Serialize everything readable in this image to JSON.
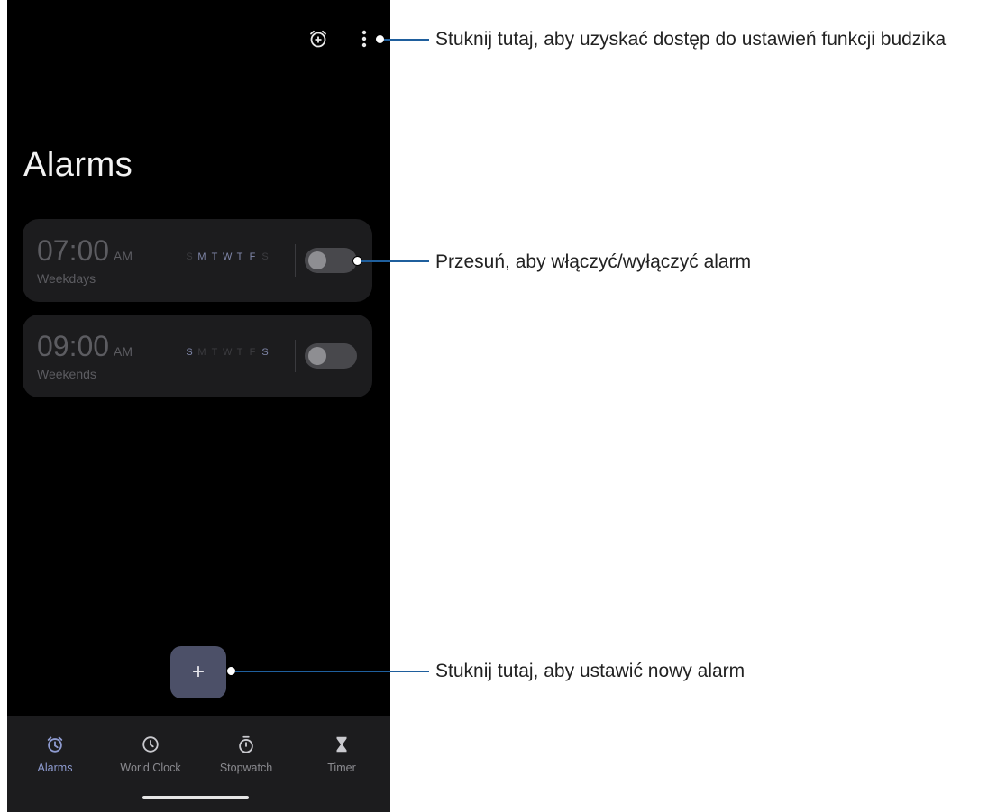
{
  "screen": {
    "title": "Alarms",
    "top_icons": [
      "add-alarm-icon",
      "more-vert-icon"
    ]
  },
  "alarms": [
    {
      "time": "07:00",
      "ampm": "AM",
      "label": "Weekdays",
      "days": [
        "S",
        "M",
        "T",
        "W",
        "T",
        "F",
        "S"
      ],
      "active_days": [
        false,
        true,
        true,
        true,
        true,
        true,
        false
      ],
      "enabled": false
    },
    {
      "time": "09:00",
      "ampm": "AM",
      "label": "Weekends",
      "days": [
        "S",
        "M",
        "T",
        "W",
        "T",
        "F",
        "S"
      ],
      "active_days": [
        true,
        false,
        false,
        false,
        false,
        false,
        true
      ],
      "enabled": false
    }
  ],
  "fab": {
    "symbol": "+"
  },
  "bottom_nav": {
    "active": "Alarms",
    "items": [
      {
        "label": "Alarms",
        "icon": "alarm-clock-icon"
      },
      {
        "label": "World Clock",
        "icon": "clock-icon"
      },
      {
        "label": "Stopwatch",
        "icon": "stopwatch-icon"
      },
      {
        "label": "Timer",
        "icon": "hourglass-icon"
      }
    ]
  },
  "callouts": [
    {
      "text": "Stuknij tutaj, aby uzyskać dostęp do ustawień funkcji budzika"
    },
    {
      "text": "Przesuń, aby włączyć/wyłączyć alarm"
    },
    {
      "text": "Stuknij tutaj, aby ustawić nowy alarm"
    }
  ],
  "colors": {
    "background": "#000000",
    "card": "#1c1c1e",
    "accent": "#8e9bd0",
    "fab": "#4c5068",
    "callout_line": "#1f5f9d"
  }
}
